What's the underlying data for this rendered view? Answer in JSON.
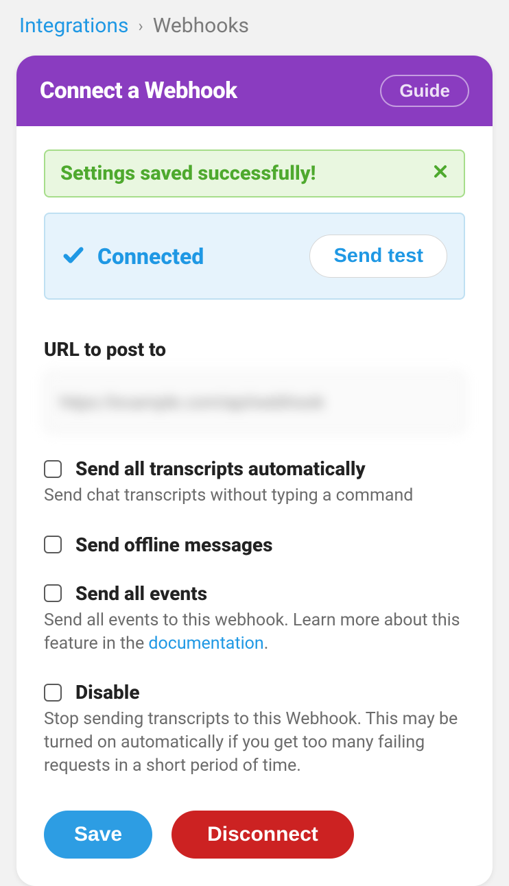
{
  "breadcrumb": {
    "parent": "Integrations",
    "current": "Webhooks"
  },
  "header": {
    "title": "Connect a Webhook",
    "guide_label": "Guide"
  },
  "alert": {
    "message": "Settings saved successfully!"
  },
  "status": {
    "label": "Connected",
    "send_test_label": "Send test"
  },
  "url_field": {
    "label": "URL to post to",
    "value": "https://example.com/api/webhook"
  },
  "options": {
    "transcripts": {
      "label": "Send all transcripts automatically",
      "desc": "Send chat transcripts without typing a command"
    },
    "offline": {
      "label": "Send offline messages"
    },
    "events": {
      "label": "Send all events",
      "desc_part1": "Send all events to this webhook. Learn more about this feature in the ",
      "desc_link": "documentation",
      "desc_part2": "."
    },
    "disable": {
      "label": "Disable",
      "desc": "Stop sending transcripts to this Webhook. This may be turned on automatically if you get too many failing requests in a short period of time."
    }
  },
  "actions": {
    "save": "Save",
    "disconnect": "Disconnect"
  }
}
